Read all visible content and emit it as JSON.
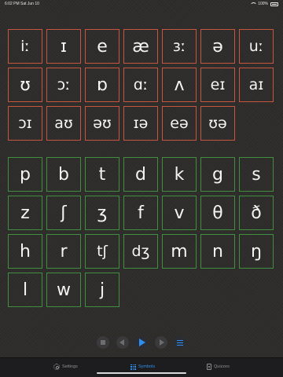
{
  "status_bar": {
    "time": "6:02 PM",
    "date": "Sat Jun 10",
    "battery": "100%"
  },
  "vowels": [
    "iː",
    "ɪ",
    "e",
    "æ",
    "ɜː",
    "ə",
    "uː",
    "ʊ",
    "ɔː",
    "ɒ",
    "ɑː",
    "ʌ",
    "eɪ",
    "aɪ",
    "ɔɪ",
    "aʊ",
    "əʊ",
    "ɪə",
    "eə",
    "ʊə"
  ],
  "consonants": [
    "p",
    "b",
    "t",
    "d",
    "k",
    "g",
    "s",
    "z",
    "ʃ",
    "ʒ",
    "f",
    "v",
    "θ",
    "ð",
    "h",
    "r",
    "tʃ",
    "dʒ",
    "m",
    "n",
    "ŋ",
    "l",
    "w",
    "j"
  ],
  "player": {
    "buttons": [
      "stop-icon",
      "previous-icon",
      "play-icon",
      "next-icon",
      "list-icon"
    ]
  },
  "tabs": [
    {
      "label": "Settings",
      "icon": "gear-icon",
      "active": false
    },
    {
      "label": "Symbols",
      "icon": "grid-icon",
      "active": true
    },
    {
      "label": "Quizzes",
      "icon": "quiz-icon",
      "active": false
    }
  ],
  "colors": {
    "vowel_border": "#c7563f",
    "consonant_border": "#3f8f3f",
    "accent": "#2f8ff0",
    "background": "#2f2d2b"
  }
}
